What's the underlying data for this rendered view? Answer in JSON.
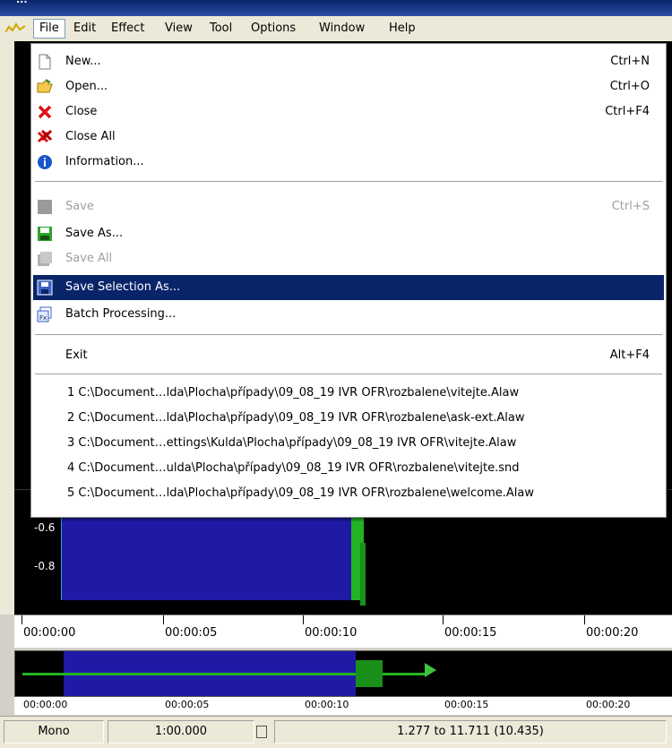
{
  "window": {
    "title": "..."
  },
  "menubar": {
    "items": [
      "File",
      "Edit",
      "Effect",
      "View",
      "Tool",
      "Options",
      "Window",
      "Help"
    ]
  },
  "file_menu": {
    "new": {
      "label": "New...",
      "shortcut": "Ctrl+N",
      "icon": "new-document-icon"
    },
    "open": {
      "label": "Open...",
      "shortcut": "Ctrl+O",
      "icon": "open-folder-icon"
    },
    "close": {
      "label": "Close",
      "shortcut": "Ctrl+F4",
      "icon": "red-x-icon"
    },
    "close_all": {
      "label": "Close All",
      "icon": "close-all-icon"
    },
    "information": {
      "label": "Information...",
      "icon": "info-icon"
    },
    "save": {
      "label": "Save",
      "shortcut": "Ctrl+S",
      "icon": "save-icon",
      "disabled": true
    },
    "save_as": {
      "label": "Save As...",
      "icon": "save-as-icon"
    },
    "save_all": {
      "label": "Save All",
      "icon": "save-all-icon",
      "disabled": true
    },
    "save_selection_as": {
      "label": "Save Selection As...",
      "icon": "save-selection-icon",
      "highlighted": true
    },
    "batch": {
      "label": "Batch Processing...",
      "icon": "batch-icon"
    },
    "exit": {
      "label": "Exit",
      "shortcut": "Alt+F4"
    },
    "recent": [
      "1 C:\\Document…lda\\Plocha\\případy\\09_08_19 IVR OFR\\rozbalene\\vitejte.Alaw",
      "2 C:\\Document…lda\\Plocha\\případy\\09_08_19 IVR OFR\\rozbalene\\ask-ext.Alaw",
      "3 C:\\Document…ettings\\Kulda\\Plocha\\případy\\09_08_19 IVR OFR\\vitejte.Alaw",
      "4 C:\\Document…ulda\\Plocha\\případy\\09_08_19 IVR OFR\\rozbalene\\vitejte.snd",
      "5 C:\\Document…lda\\Plocha\\případy\\09_08_19 IVR OFR\\rozbalene\\welcome.Alaw"
    ]
  },
  "waveform": {
    "amplitude_labels": [
      "-0.6",
      "-0.8"
    ]
  },
  "timeline": {
    "ticks": [
      "00:00:00",
      "00:00:05",
      "00:00:10",
      "00:00:15",
      "00:00:20"
    ]
  },
  "overview_timeline": {
    "ticks": [
      "00:00:00",
      "00:00:05",
      "00:00:10",
      "00:00:15",
      "00:00:20"
    ]
  },
  "status": {
    "channels": "Mono",
    "length": "1:00.000",
    "selection": "1.277 to 11.711 (10.435)"
  },
  "colors": {
    "menu_highlight": "#0a246a",
    "selection": "#1f1aa6",
    "waveform": "#22b322"
  }
}
